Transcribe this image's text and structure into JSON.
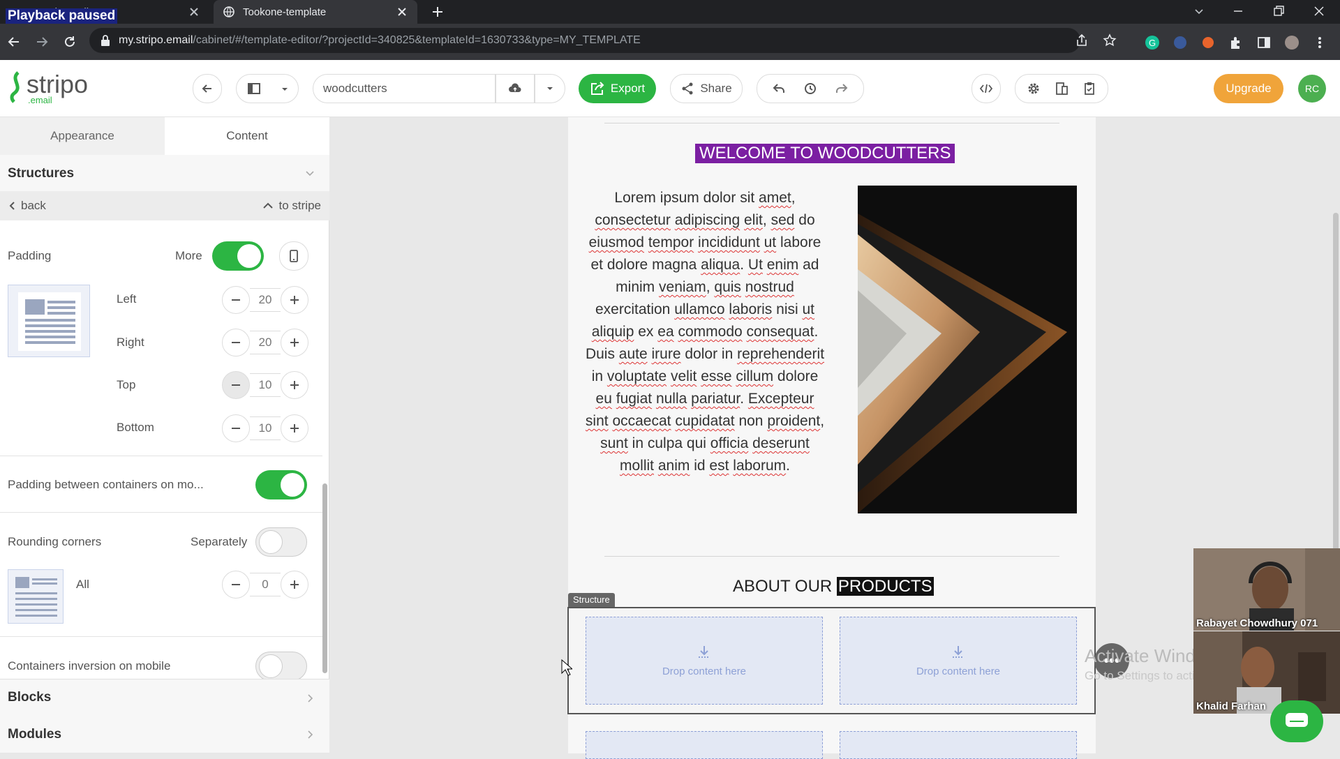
{
  "overlay": {
    "playback_paused": "Playback paused"
  },
  "browser": {
    "tabs": [
      {
        "title": "Template editor",
        "active": false
      },
      {
        "title": "Tookone-template",
        "active": true
      }
    ],
    "url_host": "my.stripo.email",
    "url_path": "/cabinet/#/template-editor/?projectId=340825&templateId=1630733&type=MY_TEMPLATE"
  },
  "header": {
    "logo_text": "stripo",
    "logo_sub": ".email",
    "template_name": "woodcutters",
    "export_label": "Export",
    "share_label": "Share",
    "upgrade_label": "Upgrade",
    "avatar_initials": "RC"
  },
  "sidebar": {
    "tabs": [
      "Appearance",
      "Content"
    ],
    "active_tab": "Content",
    "structures_title": "Structures",
    "back_label": "back",
    "to_stripe_label": "to stripe",
    "padding": {
      "label": "Padding",
      "more_label": "More",
      "more_on": true,
      "left_label": "Left",
      "left": "20",
      "right_label": "Right",
      "right": "20",
      "top_label": "Top",
      "top": "10",
      "bottom_label": "Bottom",
      "bottom": "10"
    },
    "padding_between_label": "Padding between containers on mo...",
    "padding_between_on": true,
    "rounding": {
      "label": "Rounding corners",
      "separately_label": "Separately",
      "separately_on": false,
      "all_label": "All",
      "all": "0"
    },
    "inversion_label": "Containers inversion on mobile",
    "inversion_on": false,
    "blocks_title": "Blocks",
    "modules_title": "Modules"
  },
  "email": {
    "welcome_title": "WELCOME TO WOODCUTTERS",
    "lorem_words": [
      "Lorem",
      "ipsum",
      "dolor",
      "sit",
      "amet,",
      "consectetur",
      "adipiscing",
      "elit,",
      "sed",
      "do",
      "eiusmod",
      "tempor",
      "incididunt",
      "ut",
      "labore",
      "et",
      "dolore",
      "magna",
      "aliqua.",
      "Ut",
      "enim",
      "ad",
      "minim",
      "veniam,",
      "quis",
      "nostrud",
      "exercitation",
      "ullamco",
      "laboris",
      "nisi",
      "ut",
      "aliquip",
      "ex",
      "ea",
      "commodo",
      "consequat.",
      "Duis",
      "aute",
      "irure",
      "dolor",
      "in",
      "reprehenderit",
      "in",
      "voluptate",
      "velit",
      "esse",
      "cillum",
      "dolore",
      "eu",
      "fugiat",
      "nulla",
      "pariatur.",
      "Excepteur",
      "sint",
      "occaecat",
      "cupidatat",
      "non",
      "proident,",
      "sunt",
      "in",
      "culpa",
      "qui",
      "officia",
      "deserunt",
      "mollit",
      "anim",
      "id",
      "est",
      "laborum."
    ],
    "misspelled": [
      "amet,",
      "consectetur",
      "adipiscing",
      "elit,",
      "sed",
      "eiusmod",
      "tempor",
      "incididunt",
      "ut",
      "aliqua.",
      "Ut",
      "enim",
      "veniam,",
      "quis",
      "nostrud",
      "ullamco",
      "laboris",
      "aliquip",
      "ea",
      "commodo",
      "consequat.",
      "aute",
      "irure",
      "reprehenderit",
      "voluptate",
      "velit",
      "esse",
      "cillum",
      "eu",
      "fugiat",
      "nulla",
      "pariatur.",
      "Excepteur",
      "sint",
      "occaecat",
      "cupidatat",
      "proident,",
      "sunt",
      "officia",
      "deserunt",
      "mollit",
      "anim",
      "est",
      "laborum"
    ],
    "about_prefix": "ABOUT OUR ",
    "about_highlight": "PRODUCTS",
    "structure_tag": "Structure",
    "drop_label": "Drop content here"
  },
  "watermark": {
    "line1": "Activate Windows",
    "line2": "Go to Settings to activate Windows."
  },
  "participants": [
    {
      "name": "Rabayet Chowdhury 071"
    },
    {
      "name": "Khalid Farhan"
    }
  ],
  "colors": {
    "accent_green": "#2cb543",
    "upgrade_orange": "#f0a43a",
    "welcome_bg": "#7b1fa2"
  }
}
